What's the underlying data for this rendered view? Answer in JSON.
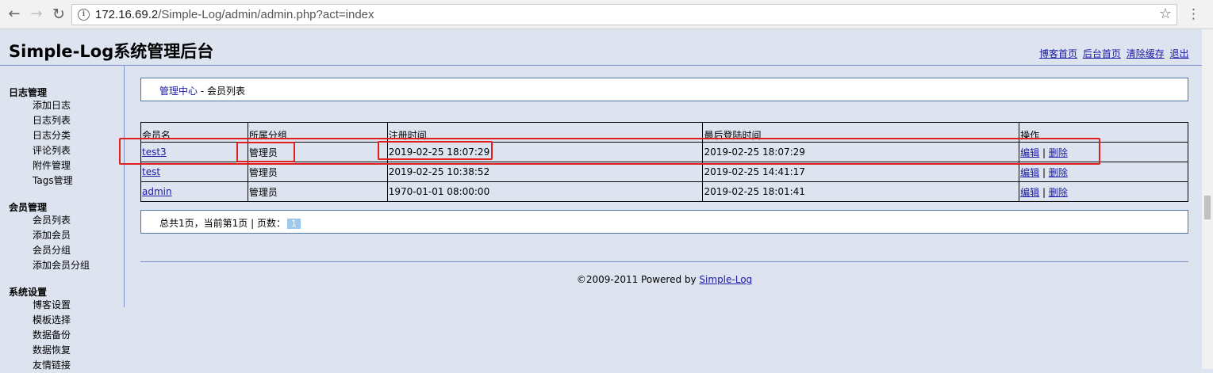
{
  "browser": {
    "url_host": "172.16.69.2",
    "url_path": "/Simple-Log/admin/admin.php?act=index",
    "icons": [
      "back-arrow-icon",
      "forward-arrow-icon",
      "reload-icon",
      "info-icon",
      "star-icon",
      "menu-icon"
    ]
  },
  "header": {
    "title": "Simple-Log系统管理后台",
    "links": [
      "博客首页",
      "后台首页",
      "清除缓存",
      "退出"
    ]
  },
  "sidebar": {
    "groups": [
      {
        "title": "日志管理",
        "items": [
          "添加日志",
          "日志列表",
          "日志分类",
          "评论列表",
          "附件管理",
          "Tags管理"
        ]
      },
      {
        "title": "会员管理",
        "items": [
          "会员列表",
          "添加会员",
          "会员分组",
          "添加会员分组"
        ]
      },
      {
        "title": "系统设置",
        "items": [
          "博客设置",
          "模板选择",
          "数据备份",
          "数据恢复",
          "友情链接"
        ]
      }
    ]
  },
  "breadcrumb": {
    "home": "管理中心",
    "separator": " - ",
    "current": "会员列表"
  },
  "table": {
    "headers": [
      "会员名",
      "所属分组",
      "注册时间",
      "最后登陆时间",
      "操作"
    ],
    "rows": [
      {
        "name": "test3",
        "group": "管理员",
        "registered": "2019-02-25 18:07:29",
        "last_login": "2019-02-25 18:07:29"
      },
      {
        "name": "test",
        "group": "管理员",
        "registered": "2019-02-25 10:38:52",
        "last_login": "2019-02-25 14:41:17"
      },
      {
        "name": "admin",
        "group": "管理员",
        "registered": "1970-01-01 08:00:00",
        "last_login": "2019-02-25 18:01:41"
      }
    ],
    "action_edit": "编辑",
    "action_sep": " | ",
    "action_delete": "删除"
  },
  "pager": {
    "text": "总共1页，当前第1页 | 页数：",
    "current_page": "1"
  },
  "footer": {
    "prefix": "©2009-2011 Powered by ",
    "link": "Simple-Log"
  },
  "colors": {
    "page_bg": "#dde3ef",
    "link": "#1a1aa6",
    "highlight": "#e0201c",
    "rule": "#7b93c9"
  }
}
